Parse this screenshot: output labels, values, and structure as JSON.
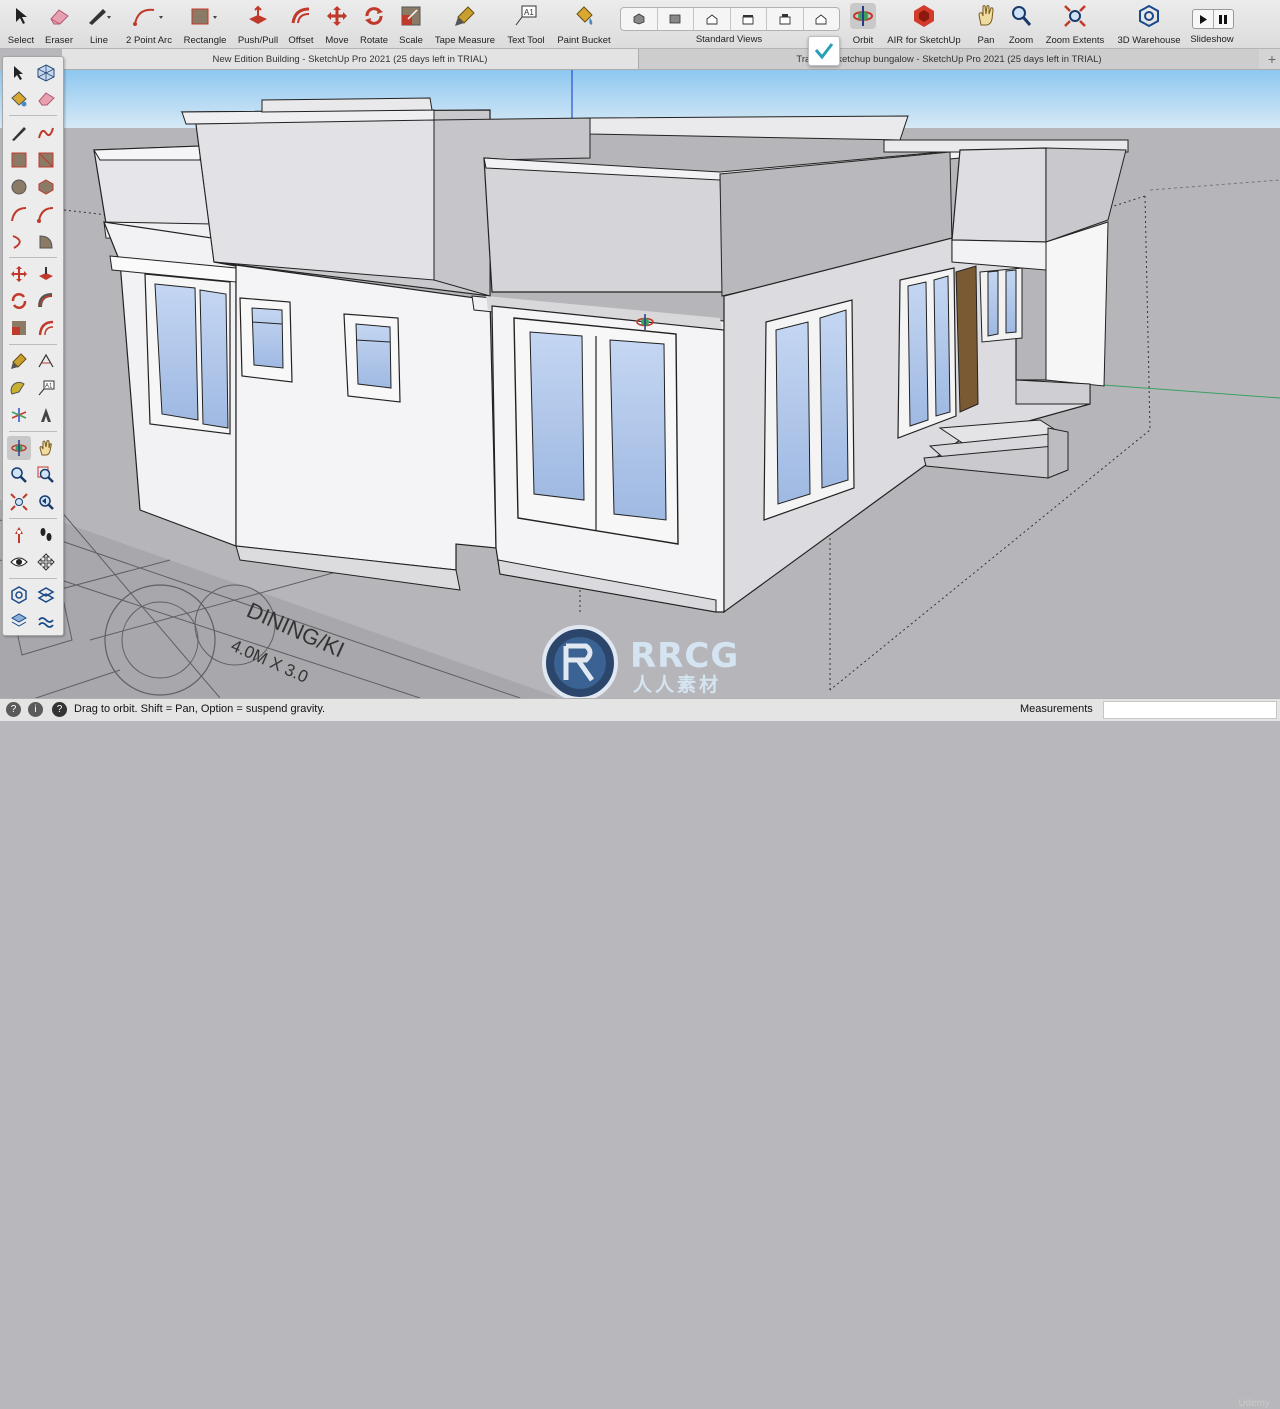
{
  "toolbar": {
    "tools": [
      {
        "key": "select",
        "label": "Select"
      },
      {
        "key": "eraser",
        "label": "Eraser"
      },
      {
        "key": "line",
        "label": "Line"
      },
      {
        "key": "arc",
        "label": "2 Point Arc"
      },
      {
        "key": "rectangle",
        "label": "Rectangle"
      },
      {
        "key": "pushpull",
        "label": "Push/Pull"
      },
      {
        "key": "offset",
        "label": "Offset"
      },
      {
        "key": "move",
        "label": "Move"
      },
      {
        "key": "rotate",
        "label": "Rotate"
      },
      {
        "key": "scale",
        "label": "Scale"
      },
      {
        "key": "tape",
        "label": "Tape Measure"
      },
      {
        "key": "text",
        "label": "Text Tool"
      },
      {
        "key": "paint",
        "label": "Paint Bucket"
      },
      {
        "key": "orbit",
        "label": "Orbit"
      },
      {
        "key": "air",
        "label": "AIR for SketchUp"
      },
      {
        "key": "pan",
        "label": "Pan"
      },
      {
        "key": "zoom",
        "label": "Zoom"
      },
      {
        "key": "zoomext",
        "label": "Zoom Extents"
      },
      {
        "key": "warehouse",
        "label": "3D Warehouse"
      },
      {
        "key": "slideshow",
        "label": "Slideshow"
      }
    ],
    "standard_views_label": "Standard Views",
    "active_tool": "Orbit"
  },
  "tabs": {
    "tab1": "New Edition Building  - SketchUp Pro 2021 (25 days left in TRIAL)",
    "tab2": "Traning Sketchup bungalow - SketchUp Pro 2021 (25 days left in TRIAL)",
    "add": "+"
  },
  "status": {
    "hint": "Drag to orbit. Shift = Pan, Option = suspend gravity.",
    "measurements_label": "Measurements",
    "measurements_value": ""
  },
  "drawing": {
    "plan_text_1": "DINING/KI",
    "plan_text_2": "4.0M X 3.0"
  },
  "watermark": {
    "line1": "RRCG",
    "line2": "人人素材",
    "udemy": "Udemy"
  },
  "colors": {
    "sky_top": "#8ec7f0",
    "sky_bottom": "#d8eaf6",
    "ground": "#b6b6ba",
    "glass": "#9fb9e2",
    "door": "#7a5a32",
    "orbit_accent": "#3aa0b8"
  }
}
